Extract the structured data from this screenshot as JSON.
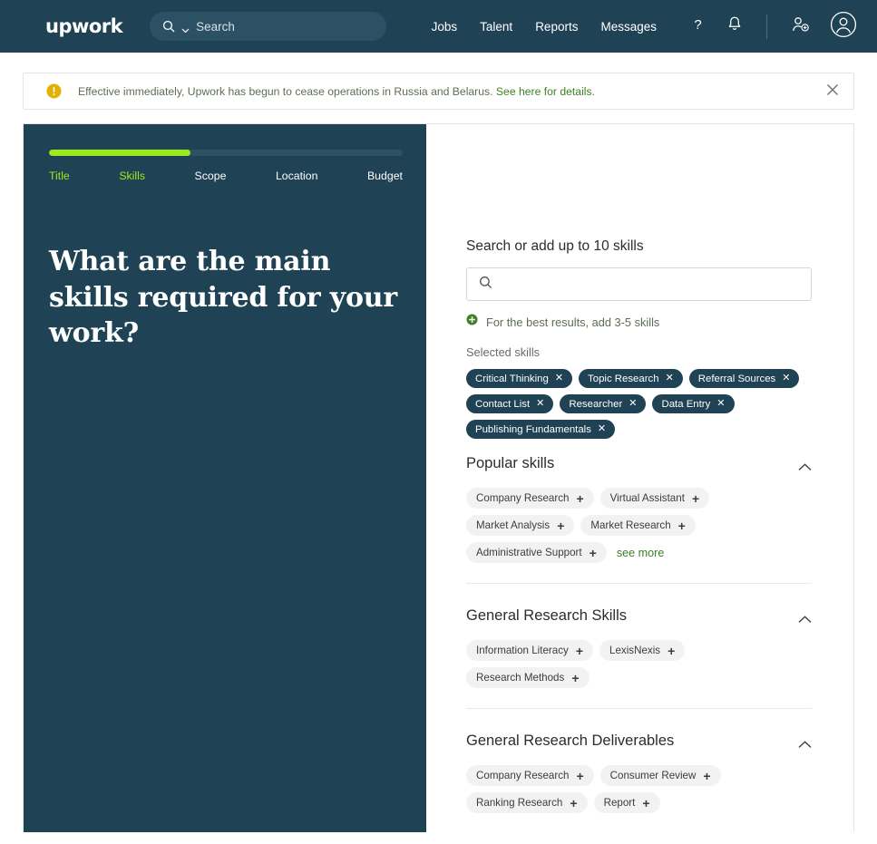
{
  "header": {
    "logo": "upwork",
    "search": {
      "placeholder": "Search",
      "value": "",
      "icon": "search-icon",
      "chevron": "chevron-down-icon"
    },
    "nav": [
      {
        "label": "Jobs"
      },
      {
        "label": "Talent"
      },
      {
        "label": "Reports"
      },
      {
        "label": "Messages"
      }
    ],
    "icons": [
      {
        "name": "help-icon",
        "glyph": "?"
      },
      {
        "name": "notifications-bell-icon"
      },
      {
        "name": "invite-user-icon"
      },
      {
        "name": "account-avatar-icon"
      }
    ],
    "bg_color": "#1f4354"
  },
  "banner": {
    "icon": "warning-icon",
    "text": "Effective immediately, Upwork has begun to cease operations in Russia and Belarus.",
    "link_text": "See here for details.",
    "close_icon": "close-icon",
    "accent_color": "#e2b203",
    "link_color": "#3c8224"
  },
  "wizard": {
    "progress_percent": 40,
    "progress_color": "#9aea1f",
    "steps": [
      {
        "label": "Title",
        "state": "done"
      },
      {
        "label": "Skills",
        "state": "active"
      },
      {
        "label": "Scope",
        "state": "upcoming"
      },
      {
        "label": "Location",
        "state": "upcoming"
      },
      {
        "label": "Budget",
        "state": "upcoming"
      }
    ],
    "question": "What are the main skills required for your work?"
  },
  "form": {
    "field_label": "Search or add up to 10 skills",
    "search_placeholder": "",
    "search_value": "",
    "search_icon": "search-icon",
    "hint": "For the best results, add 3-5 skills",
    "hint_icon": "add-circle-icon",
    "hint_color": "#3c8224",
    "selected_label": "Selected skills",
    "selected_skills": [
      {
        "label": "Critical Thinking"
      },
      {
        "label": "Topic Research"
      },
      {
        "label": "Referral Sources"
      },
      {
        "label": "Contact List"
      },
      {
        "label": "Researcher"
      },
      {
        "label": "Data Entry"
      },
      {
        "label": "Publishing Fundamentals"
      }
    ],
    "remove_glyph": "✕"
  },
  "sections": [
    {
      "title": "Popular skills",
      "collapse_icon": "chevron-up-icon",
      "chips": [
        {
          "label": "Company Research"
        },
        {
          "label": "Virtual Assistant"
        },
        {
          "label": "Market Analysis"
        },
        {
          "label": "Market Research"
        },
        {
          "label": "Administrative Support"
        }
      ],
      "see_more": "see more"
    },
    {
      "title": "General Research Skills",
      "collapse_icon": "chevron-up-icon",
      "chips": [
        {
          "label": "Information Literacy"
        },
        {
          "label": "LexisNexis"
        },
        {
          "label": "Research Methods"
        }
      ],
      "see_more": ""
    },
    {
      "title": "General Research Deliverables",
      "collapse_icon": "chevron-up-icon",
      "chips": [
        {
          "label": "Company Research"
        },
        {
          "label": "Consumer Review"
        },
        {
          "label": "Ranking Research"
        },
        {
          "label": "Report"
        }
      ],
      "see_more": ""
    }
  ],
  "add_glyph": "+"
}
